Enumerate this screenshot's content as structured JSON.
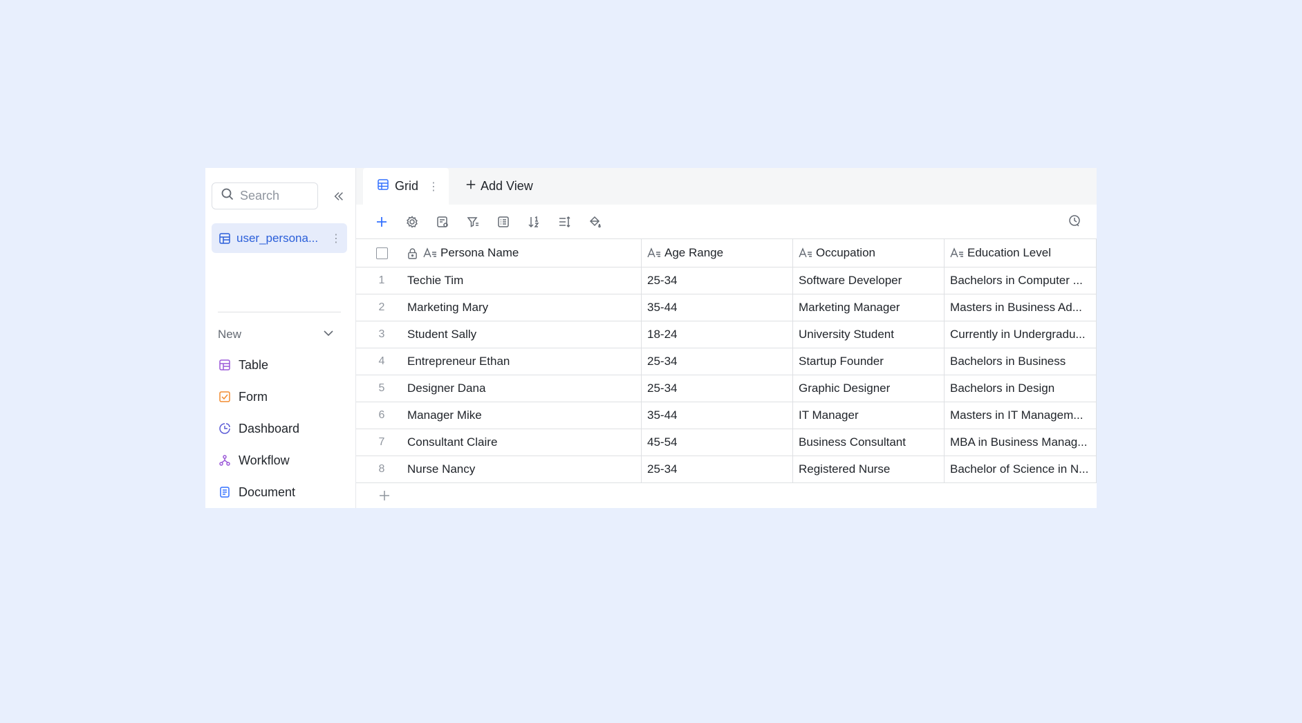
{
  "sidebar": {
    "search_placeholder": "Search",
    "table_item": {
      "label": "user_persona...",
      "icon": "table-icon"
    },
    "new_section": {
      "label": "New",
      "items": [
        {
          "label": "Table",
          "icon": "table-icon",
          "color": "#9b59d8"
        },
        {
          "label": "Form",
          "icon": "form-icon",
          "color": "#f28b30"
        },
        {
          "label": "Dashboard",
          "icon": "dashboard-icon",
          "color": "#5b5bd6"
        },
        {
          "label": "Workflow",
          "icon": "workflow-icon",
          "color": "#9b59d8"
        },
        {
          "label": "Document",
          "icon": "document-icon",
          "color": "#3370ff"
        }
      ]
    }
  },
  "tabs": {
    "active": {
      "label": "Grid",
      "icon": "grid-icon"
    },
    "add_view": "Add View"
  },
  "toolbar": {
    "buttons": [
      "add-icon",
      "settings-icon",
      "field-icon",
      "filter-icon",
      "group-icon",
      "sort-icon",
      "row-height-icon",
      "paint-bucket-icon"
    ],
    "history": "history-icon"
  },
  "grid": {
    "columns": [
      "Persona Name",
      "Age Range",
      "Occupation",
      "Education Level"
    ],
    "rows": [
      {
        "index": "1",
        "name": "Techie Tim",
        "age": "25-34",
        "occupation": "Software Developer",
        "education": "Bachelors in Computer ..."
      },
      {
        "index": "2",
        "name": "Marketing Mary",
        "age": "35-44",
        "occupation": "Marketing Manager",
        "education": "Masters in Business Ad..."
      },
      {
        "index": "3",
        "name": "Student Sally",
        "age": "18-24",
        "occupation": "University Student",
        "education": "Currently in Undergradu..."
      },
      {
        "index": "4",
        "name": "Entrepreneur Ethan",
        "age": "25-34",
        "occupation": "Startup Founder",
        "education": "Bachelors in Business"
      },
      {
        "index": "5",
        "name": "Designer Dana",
        "age": "25-34",
        "occupation": "Graphic Designer",
        "education": "Bachelors in Design"
      },
      {
        "index": "6",
        "name": "Manager Mike",
        "age": "35-44",
        "occupation": "IT Manager",
        "education": "Masters in IT Managem..."
      },
      {
        "index": "7",
        "name": "Consultant Claire",
        "age": "45-54",
        "occupation": "Business Consultant",
        "education": "MBA in Business Manag..."
      },
      {
        "index": "8",
        "name": "Nurse Nancy",
        "age": "25-34",
        "occupation": "Registered Nurse",
        "education": "Bachelor of Science in N..."
      }
    ]
  },
  "colors": {
    "accent": "#3370ff",
    "background": "#e8effd",
    "selected_bg": "#e6ecfb"
  }
}
